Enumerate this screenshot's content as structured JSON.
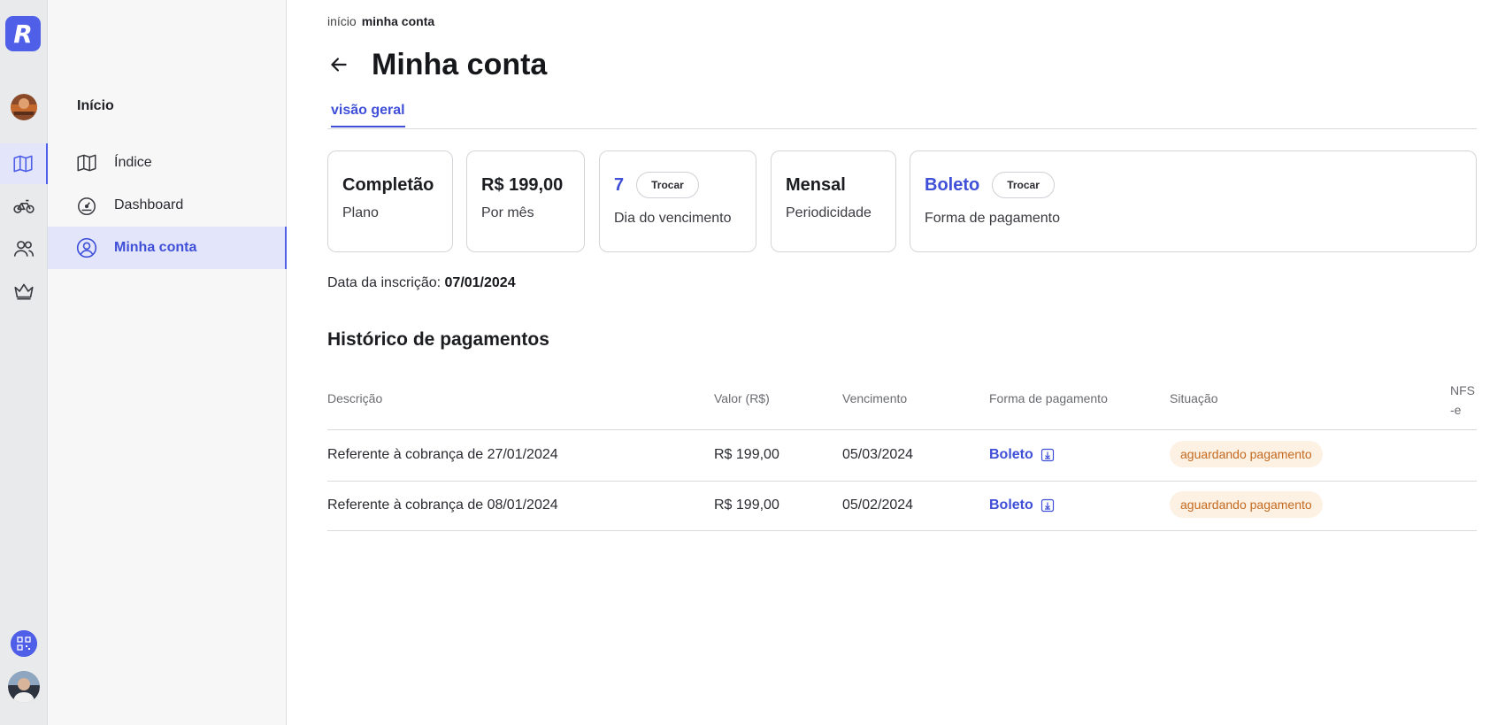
{
  "rail": {
    "logo_letter": "R",
    "icons": [
      "map-icon",
      "bike-icon",
      "users-icon",
      "crown-icon"
    ],
    "active_icon": "map-icon"
  },
  "subnav": {
    "title": "Início",
    "items": [
      {
        "label": "Índice",
        "icon": "map-icon"
      },
      {
        "label": "Dashboard",
        "icon": "gauge-icon"
      },
      {
        "label": "Minha conta",
        "icon": "user-circle-icon",
        "active": true
      }
    ]
  },
  "breadcrumb": {
    "root": "início",
    "current": "minha conta"
  },
  "page_title": "Minha conta",
  "tabs": [
    {
      "label": "visão geral",
      "active": true
    }
  ],
  "cards": {
    "plan": {
      "value": "Completão",
      "label": "Plano"
    },
    "price": {
      "value": "R$ 199,00",
      "label": "Por mês"
    },
    "due_day": {
      "value": "7",
      "button": "Trocar",
      "label": "Dia do vencimento"
    },
    "periodicity": {
      "value": "Mensal",
      "label": "Periodicidade"
    },
    "payment_method": {
      "value": "Boleto",
      "button": "Trocar",
      "label": "Forma de pagamento"
    }
  },
  "subscription": {
    "label": "Data da inscrição:",
    "date": "07/01/2024"
  },
  "history": {
    "title": "Histórico de pagamentos",
    "columns": [
      "Descrição",
      "Valor (R$)",
      "Vencimento",
      "Forma de pagamento",
      "Situação",
      "NFS-e"
    ],
    "rows": [
      {
        "description": "Referente à cobrança de 27/01/2024",
        "value": "R$ 199,00",
        "due": "05/03/2024",
        "method": "Boleto",
        "status": "aguardando pagamento"
      },
      {
        "description": "Referente à cobrança de 08/01/2024",
        "value": "R$ 199,00",
        "due": "05/02/2024",
        "method": "Boleto",
        "status": "aguardando pagamento"
      }
    ]
  },
  "colors": {
    "accent": "#4f5fe8",
    "status_pending_bg": "#fdf1e3",
    "status_pending_text": "#c4691f"
  }
}
